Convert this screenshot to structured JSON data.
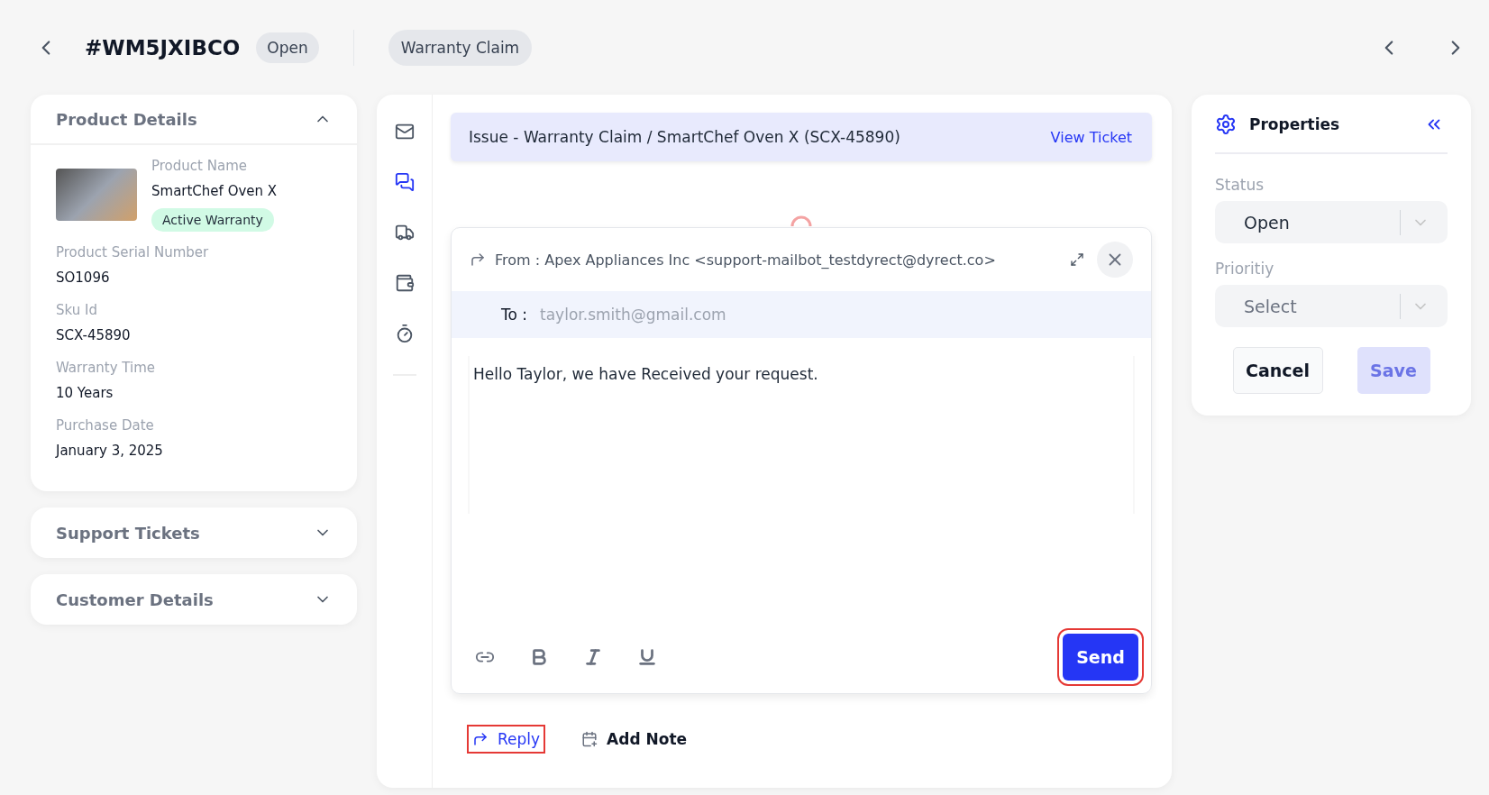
{
  "header": {
    "ticket_id": "#WM5JXIBCO",
    "status_badge": "Open",
    "category_tag": "Warranty Claim"
  },
  "left_panel": {
    "sections": [
      {
        "title": "Product Details",
        "expanded": true,
        "product_name_label": "Product Name",
        "product_name": "SmartChef Oven X",
        "warranty_badge": "Active Warranty",
        "fields": [
          {
            "label": "Product Serial Number",
            "value": "SO1096"
          },
          {
            "label": "Sku Id",
            "value": "SCX-45890"
          },
          {
            "label": "Warranty Time",
            "value": "10 Years"
          },
          {
            "label": "Purchase Date",
            "value": "January 3, 2025"
          }
        ]
      },
      {
        "title": "Support Tickets",
        "expanded": false
      },
      {
        "title": "Customer Details",
        "expanded": false
      }
    ]
  },
  "side_icons": [
    {
      "kind": "mail",
      "selected": false
    },
    {
      "kind": "chat",
      "selected": true
    },
    {
      "kind": "truck",
      "selected": false
    },
    {
      "kind": "wallet",
      "selected": false
    },
    {
      "kind": "timer",
      "selected": false
    }
  ],
  "banner": {
    "text": "Issue - Warranty Claim / SmartChef Oven X (SCX-45890)",
    "link": "View Ticket"
  },
  "compose": {
    "from_label": "From :",
    "from": "Apex Appliances Inc <support-mailbot_testdyrect@dyrect.co>",
    "to_label": "To :",
    "to": "taylor.smith@gmail.com",
    "body": "Hello Taylor, we have Received your request.",
    "format_tools": [
      {
        "kind": "link"
      },
      {
        "kind": "bold"
      },
      {
        "kind": "italic"
      },
      {
        "kind": "underline"
      }
    ],
    "send_button": "Send",
    "send_highlighted": true
  },
  "actions": [
    {
      "kind": "reply",
      "label": "Reply",
      "selected": true,
      "highlighted": true
    },
    {
      "kind": "note",
      "label": "Add Note",
      "selected": false,
      "highlighted": false
    }
  ],
  "properties": {
    "title": "Properties",
    "fields": [
      {
        "label": "Status",
        "value": "Open"
      },
      {
        "label": "Prioritiy",
        "placeholder": "Select"
      }
    ],
    "cancel_button": "Cancel",
    "save_button": "Save",
    "save_disabled": true
  }
}
